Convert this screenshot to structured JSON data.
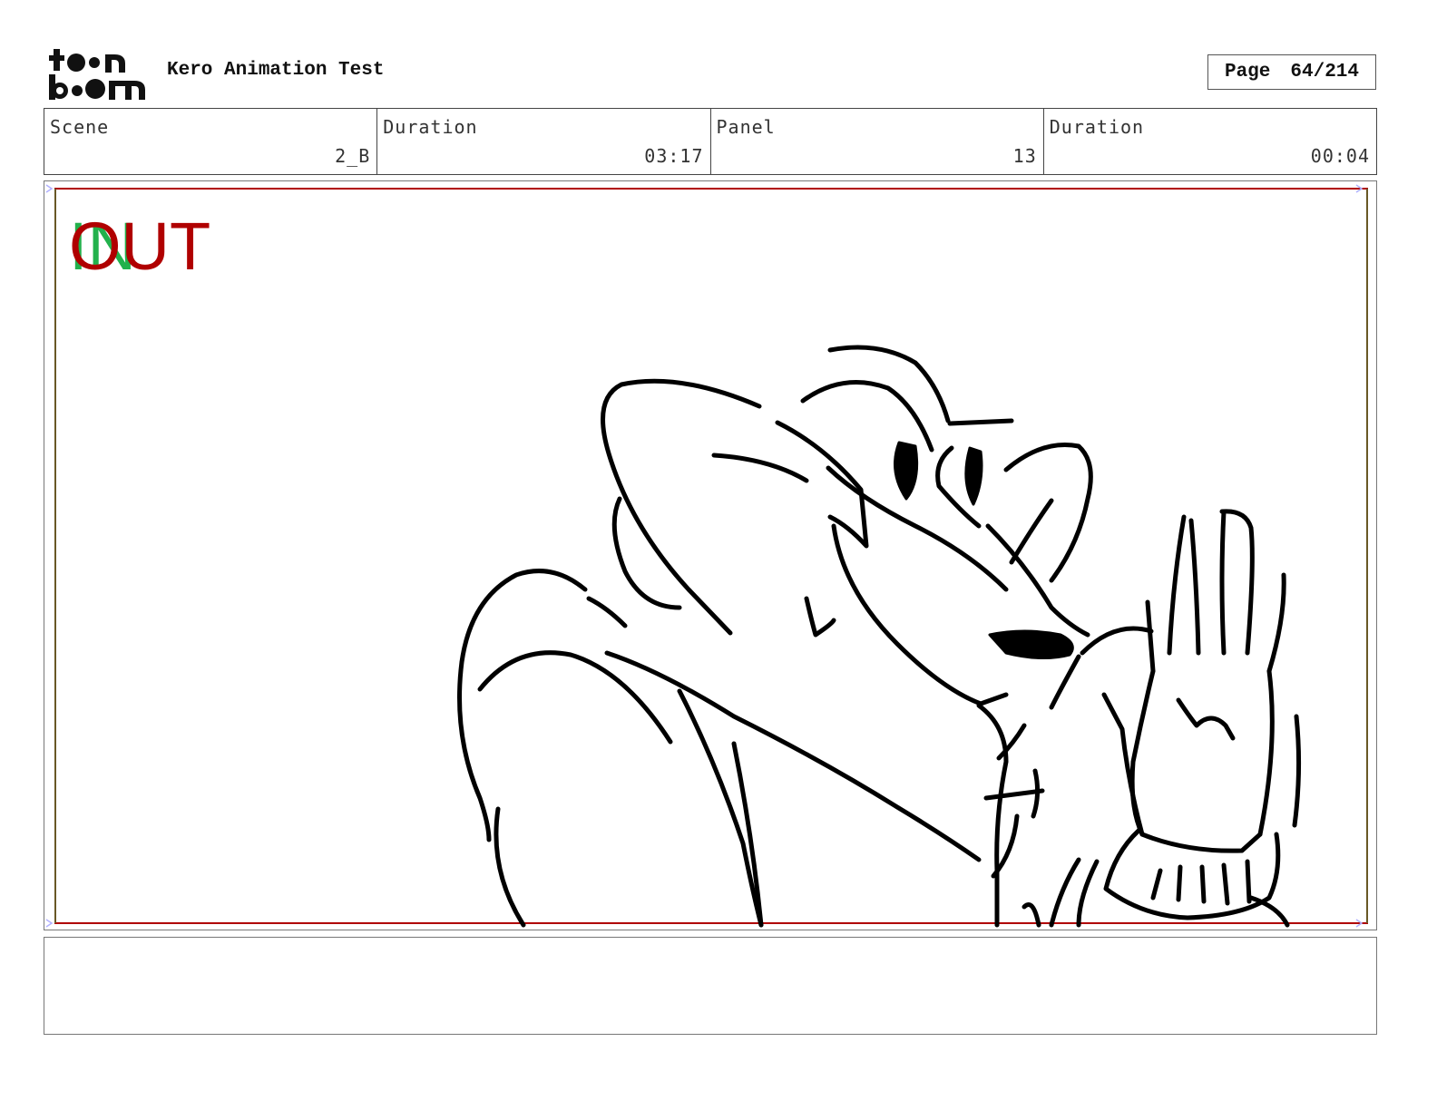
{
  "header": {
    "logo": {
      "line1": "toon",
      "line2": "boom",
      "icon": "toon-boom-logo-icon"
    },
    "project_title": "Kero Animation Test",
    "page_label": "Page",
    "page_value": "64/214"
  },
  "info": {
    "scene_label": "Scene",
    "scene_value": "2_B",
    "scene_duration_label": "Duration",
    "scene_duration_value": "03:17",
    "panel_label": "Panel",
    "panel_value": "13",
    "panel_duration_label": "Duration",
    "panel_duration_value": "00:04"
  },
  "panel": {
    "in_marker": "IN",
    "out_marker": "OUT",
    "in_color": "#22b14c",
    "out_color": "#b00000",
    "drawing": "character-sketch-icon"
  },
  "caption": {
    "text": ""
  }
}
